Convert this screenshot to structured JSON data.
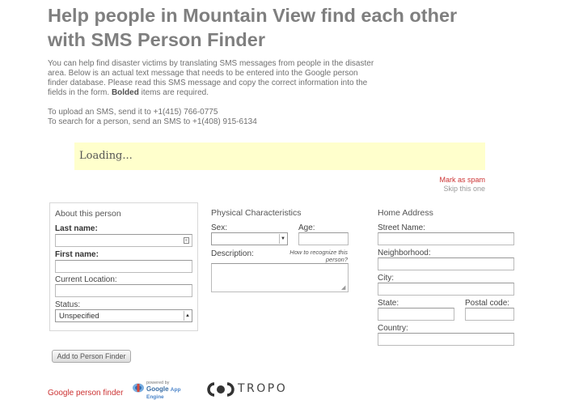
{
  "page": {
    "title_line1": "Help people in Mountain View find each other",
    "title_line2": "with SMS Person Finder",
    "intro_text": "You can help find disaster victims by translating SMS messages from people in the disaster area. Below is an actual text message that needs to be entered into the Google person finder database. Please read this SMS message and copy the correct information into the fields in the form.",
    "intro_bold": "Bolded",
    "intro_tail": " items are required.",
    "upload_line": "To upload an SMS, send it to +1(415) 766-0775",
    "search_line": "To search for a person, send an SMS to +1(408) 915-6134"
  },
  "message": {
    "text": "Loading..."
  },
  "actions": {
    "mark_spam": "Mark as spam",
    "skip": "Skip this one"
  },
  "about": {
    "title": "About this person",
    "last_name_label": "Last name:",
    "first_name_label": "First name:",
    "location_label": "Current Location:",
    "status_label": "Status:",
    "status_value": "Unspecified"
  },
  "physical": {
    "title": "Physical Characteristics",
    "sex_label": "Sex:",
    "age_label": "Age:",
    "description_label": "Description:",
    "hint": "How to recognize this person?"
  },
  "address": {
    "title": "Home Address",
    "street_label": "Street Name:",
    "neighborhood_label": "Neighborhood:",
    "city_label": "City:",
    "state_label": "State:",
    "postal_label": "Postal code:",
    "country_label": "Country:"
  },
  "submit": {
    "label": "Add to Person Finder"
  },
  "footer": {
    "link": "Google person finder",
    "powered_by": "powered by",
    "gae_brand": "Google",
    "gae_product": "App Engine",
    "tropo": "TROPO"
  }
}
